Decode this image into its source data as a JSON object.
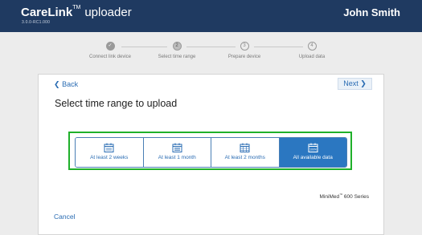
{
  "header": {
    "brand": "CareLink",
    "trademark": "TM",
    "product": "uploader",
    "version": "3.0.0-RC1.000",
    "user": "John Smith"
  },
  "steps": [
    {
      "number": "✓",
      "label": "Connect link device",
      "state": "done"
    },
    {
      "number": "2",
      "label": "Select time range",
      "state": "current"
    },
    {
      "number": "3",
      "label": "Prepare device",
      "state": "pending"
    },
    {
      "number": "4",
      "label": "Upload data",
      "state": "pending"
    }
  ],
  "nav": {
    "back_label": "Back",
    "next_label": "Next",
    "cancel_label": "Cancel"
  },
  "page": {
    "title": "Select time range to upload"
  },
  "range_options": [
    {
      "label": "At least 2 weeks",
      "icon": "calendar-icon",
      "selected": false
    },
    {
      "label": "At least 1 month",
      "icon": "calendar-icon",
      "selected": false
    },
    {
      "label": "At least 2 months",
      "icon": "calendar-grid-icon",
      "selected": false
    },
    {
      "label": "All available data",
      "icon": "calendar-100-icon",
      "icon_text": "100%",
      "selected": true
    }
  ],
  "device": {
    "model": "MiniMed",
    "trademark": "™",
    "series": "600 Series"
  },
  "colors": {
    "header_bg": "#1f3a61",
    "accent": "#2a6cb3",
    "selected_bg": "#2b77c1",
    "highlight_frame": "#1fb02a"
  }
}
